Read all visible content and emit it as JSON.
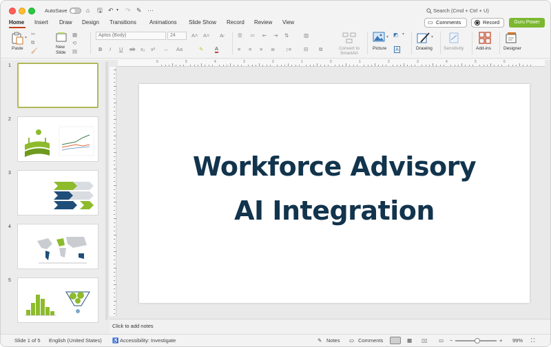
{
  "titlebar": {
    "autosave_label": "AutoSave",
    "search_placeholder": "Search (Cmd + Ctrl + U)",
    "more": "···"
  },
  "tabs": [
    {
      "label": "Home"
    },
    {
      "label": "Insert"
    },
    {
      "label": "Draw"
    },
    {
      "label": "Design"
    },
    {
      "label": "Transitions"
    },
    {
      "label": "Animations"
    },
    {
      "label": "Slide Show"
    },
    {
      "label": "Record"
    },
    {
      "label": "Review"
    },
    {
      "label": "View"
    }
  ],
  "tab_actions": {
    "comments": "Comments",
    "record": "Record",
    "guru": "Guru Power"
  },
  "ribbon": {
    "paste": "Paste",
    "new_slide_1": "New",
    "new_slide_2": "Slide",
    "font_name": "Aptos (Body)",
    "font_size": "24",
    "convert_1": "Convert to",
    "convert_2": "SmartArt",
    "picture": "Picture",
    "drawing": "Drawing",
    "sensitivity": "Sensitivity",
    "addins": "Add-ins",
    "designer": "Designer"
  },
  "slides": [
    {
      "num": "1"
    },
    {
      "num": "2"
    },
    {
      "num": "3"
    },
    {
      "num": "4"
    },
    {
      "num": "5"
    }
  ],
  "slide": {
    "title_line1": "Workforce Advisory",
    "title_line2": "AI Integration"
  },
  "ruler": {
    "labels": [
      "6",
      "5",
      "4",
      "3",
      "2",
      "1",
      "0",
      "1",
      "2",
      "3",
      "4",
      "5",
      "6"
    ]
  },
  "notes": {
    "placeholder": "Click to add notes"
  },
  "status": {
    "slide_count": "Slide 1 of 5",
    "language": "English (United States)",
    "accessibility": "Accessibility: Investigate",
    "notes": "Notes",
    "comments": "Comments",
    "zoom": "99%"
  },
  "colors": {
    "title": "#12344d",
    "accent_tab": "#c43e1c",
    "guru": "#7cb82f",
    "thumb_green": "#8dbb2c",
    "thumb_blue": "#1f4e79"
  }
}
